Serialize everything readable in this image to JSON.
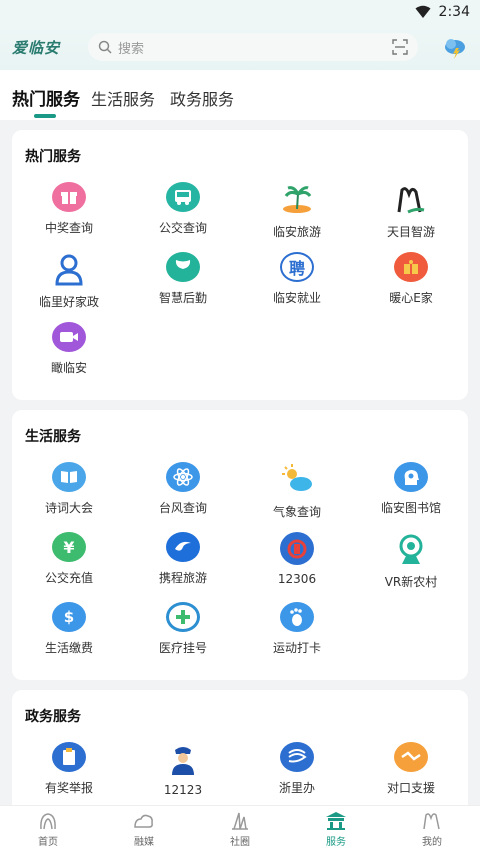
{
  "status": {
    "time": "2:34"
  },
  "header": {
    "logo": "爱临安",
    "search_placeholder": "搜索"
  },
  "tabs": [
    "热门服务",
    "生活服务",
    "政务服务"
  ],
  "sections": {
    "hot": {
      "title": "热门服务",
      "items": [
        "中奖查询",
        "公交查询",
        "临安旅游",
        "天目智游",
        "临里好家政",
        "智慧后勤",
        "临安就业",
        "暖心E家",
        "瞰临安"
      ]
    },
    "life": {
      "title": "生活服务",
      "items": [
        "诗词大会",
        "台风查询",
        "气象查询",
        "临安图书馆",
        "公交充值",
        "携程旅游",
        "12306",
        "VR新农村",
        "生活缴费",
        "医疗挂号",
        "运动打卡"
      ]
    },
    "gov": {
      "title": "政务服务",
      "items": [
        "有奖举报",
        "12123",
        "浙里办",
        "对口支援"
      ]
    }
  },
  "bottom_nav": [
    "首页",
    "融媒",
    "社圈",
    "服务",
    "我的"
  ],
  "colors": {
    "accent": "#1a9a86"
  }
}
